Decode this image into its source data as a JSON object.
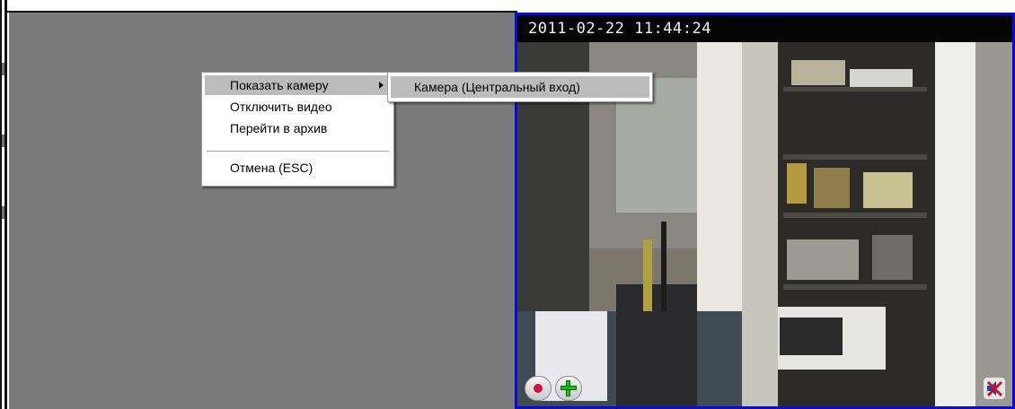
{
  "camera": {
    "timestamp": "2011-02-22 11:44:24",
    "border_color": "#0a0ad8"
  },
  "context_menu": {
    "items": [
      {
        "label": "Показать камеру",
        "has_submenu": true,
        "highlighted": true
      },
      {
        "label": "Отключить видео",
        "has_submenu": false
      },
      {
        "label": "Перейти в архив",
        "has_submenu": false
      },
      {
        "label": "Отмена (ESC)",
        "has_submenu": false
      }
    ]
  },
  "submenu": {
    "items": [
      {
        "label": "Камера (Центральный вход)",
        "highlighted": true
      }
    ]
  },
  "controls": {
    "record_icon": "record-icon",
    "add_icon": "plus-icon",
    "mute_icon": "speaker-muted-icon"
  }
}
